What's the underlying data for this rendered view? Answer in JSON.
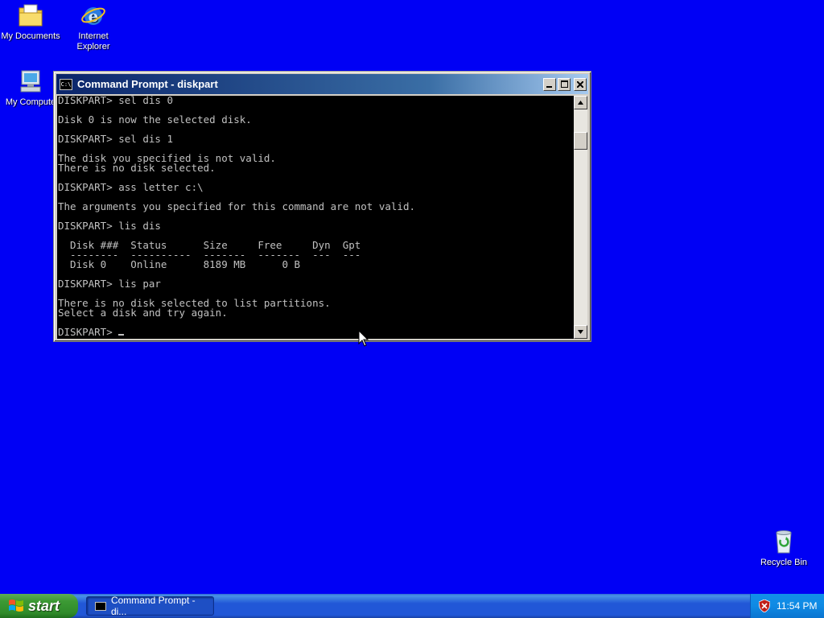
{
  "desktop": {
    "icons": [
      {
        "label": "My Documents",
        "icon": "my-documents-icon"
      },
      {
        "label": "Internet\nExplorer",
        "icon": "internet-explorer-icon"
      },
      {
        "label": "My Compute",
        "icon": "my-computer-icon"
      },
      {
        "label": "Recycle Bin",
        "icon": "recycle-bin-icon"
      }
    ]
  },
  "window": {
    "title": "Command Prompt - diskpart",
    "icon_text": "C:\\",
    "console_lines": [
      "DISKPART> sel dis 0",
      "",
      "Disk 0 is now the selected disk.",
      "",
      "DISKPART> sel dis 1",
      "",
      "The disk you specified is not valid.",
      "There is no disk selected.",
      "",
      "DISKPART> ass letter c:\\",
      "",
      "The arguments you specified for this command are not valid.",
      "",
      "DISKPART> lis dis",
      "",
      "  Disk ###  Status      Size     Free     Dyn  Gpt",
      "  --------  ----------  -------  -------  ---  ---",
      "  Disk 0    Online      8189 MB      0 B",
      "",
      "DISKPART> lis par",
      "",
      "There is no disk selected to list partitions.",
      "Select a disk and try again.",
      ""
    ],
    "prompt": "DISKPART> "
  },
  "taskbar": {
    "start_label": "start",
    "task_label": "Command Prompt - di...",
    "clock": "11:54 PM"
  },
  "colors": {
    "desktop": "#0000f5",
    "console_bg": "#000000",
    "console_fg": "#c0c0c0"
  }
}
